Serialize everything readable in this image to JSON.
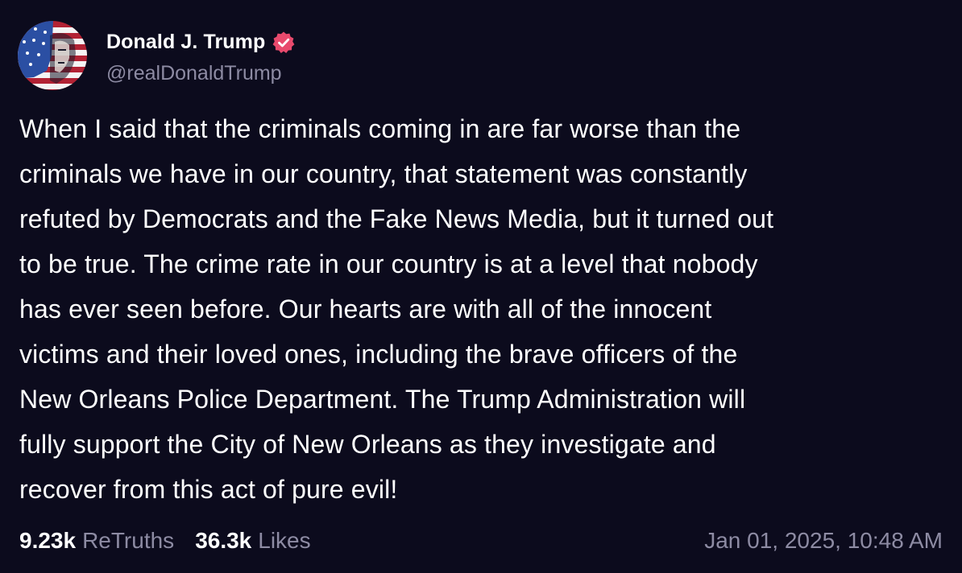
{
  "author": {
    "display_name": "Donald J. Trump",
    "handle": "@realDonaldTrump",
    "verified": true,
    "verified_color": "#e84a6d",
    "avatar_icon": "flag-portrait-avatar"
  },
  "post": {
    "lines": [
      "When I said that the criminals coming in are far worse than the",
      "criminals we have in our country, that statement was constantly",
      "refuted by Democrats and the Fake News Media, but it turned out",
      "to be true. The crime rate in our country is at a level that nobody",
      "has ever seen before. Our hearts are with all of the innocent",
      "victims and their loved ones, including the brave officers of the",
      "New Orleans Police Department. The Trump Administration will",
      "fully support the City of New Orleans as they investigate and",
      "recover from this act of pure evil!"
    ]
  },
  "stats": {
    "retruths_count": "9.23k",
    "retruths_label": "ReTruths",
    "likes_count": "36.3k",
    "likes_label": "Likes"
  },
  "timestamp": "Jan 01, 2025, 10:48 AM",
  "colors": {
    "background": "#0c0b1d",
    "text_primary": "#ffffff",
    "text_secondary": "#8d8ba3"
  }
}
